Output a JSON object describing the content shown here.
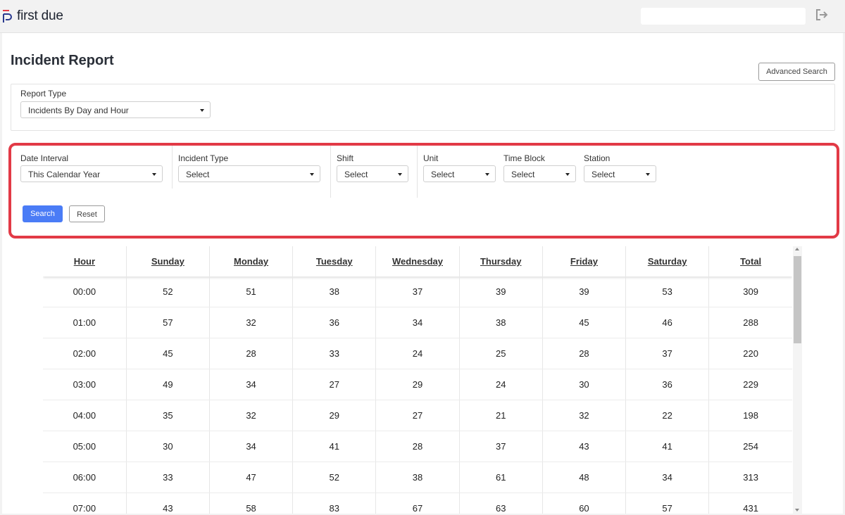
{
  "header": {
    "logo_text": "first due",
    "search_placeholder": "",
    "colors": {
      "logo_red": "#e23a46",
      "logo_blue": "#2a3a8f"
    }
  },
  "page": {
    "title": "Incident Report",
    "advanced_search_label": "Advanced Search"
  },
  "report_type": {
    "label": "Report Type",
    "value": "Incidents By Day and Hour"
  },
  "filters": {
    "date_interval": {
      "label": "Date Interval",
      "value": "This Calendar Year"
    },
    "incident_type": {
      "label": "Incident Type",
      "value": "Select"
    },
    "shift": {
      "label": "Shift",
      "value": "Select"
    },
    "unit": {
      "label": "Unit",
      "value": "Select"
    },
    "time_block": {
      "label": "Time Block",
      "value": "Select"
    },
    "station": {
      "label": "Station",
      "value": "Select"
    },
    "search_label": "Search",
    "reset_label": "Reset",
    "highlight_color": "#e23a46",
    "accent_color": "#4a7cf6"
  },
  "table": {
    "columns": [
      "Hour",
      "Sunday",
      "Monday",
      "Tuesday",
      "Wednesday",
      "Thursday",
      "Friday",
      "Saturday",
      "Total"
    ],
    "rows": [
      [
        "00:00",
        "52",
        "51",
        "38",
        "37",
        "39",
        "39",
        "53",
        "309"
      ],
      [
        "01:00",
        "57",
        "32",
        "36",
        "34",
        "38",
        "45",
        "46",
        "288"
      ],
      [
        "02:00",
        "45",
        "28",
        "33",
        "24",
        "25",
        "28",
        "37",
        "220"
      ],
      [
        "03:00",
        "49",
        "34",
        "27",
        "29",
        "24",
        "30",
        "36",
        "229"
      ],
      [
        "04:00",
        "35",
        "32",
        "29",
        "27",
        "21",
        "32",
        "22",
        "198"
      ],
      [
        "05:00",
        "30",
        "34",
        "41",
        "28",
        "37",
        "43",
        "41",
        "254"
      ],
      [
        "06:00",
        "33",
        "47",
        "52",
        "38",
        "61",
        "48",
        "34",
        "313"
      ],
      [
        "07:00",
        "43",
        "58",
        "83",
        "67",
        "63",
        "60",
        "57",
        "431"
      ]
    ]
  }
}
